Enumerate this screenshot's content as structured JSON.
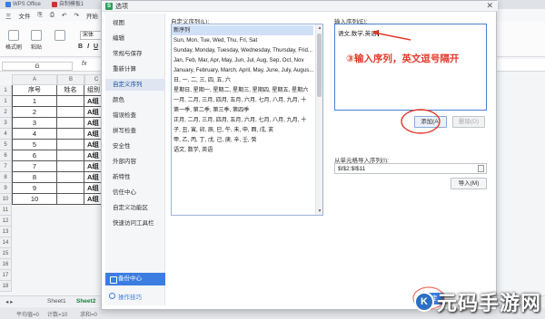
{
  "top_tabs": [
    {
      "label": "WPS Office"
    },
    {
      "label": "自制模板1"
    }
  ],
  "menu": [
    "三",
    "文件",
    "⎘",
    "⎙",
    "↶",
    "↷",
    "开始"
  ],
  "ribbon": {
    "format_painter": "格式刷",
    "paste": "粘贴",
    "font_name": "宋体"
  },
  "name_box": "G",
  "formula_icon": "fx",
  "columns": [
    "A",
    "B",
    "C"
  ],
  "sheet": {
    "headers": {
      "seq": "序号",
      "name": "姓名",
      "group": "组别"
    },
    "rows": [
      {
        "num": "1",
        "seq": "1",
        "group": "A组"
      },
      {
        "num": "2",
        "seq": "2",
        "group": "A组"
      },
      {
        "num": "3",
        "seq": "3",
        "group": "A组"
      },
      {
        "num": "4",
        "seq": "4",
        "group": "A组"
      },
      {
        "num": "5",
        "seq": "5",
        "group": "A组"
      },
      {
        "num": "6",
        "seq": "6",
        "group": "A组"
      },
      {
        "num": "7",
        "seq": "7",
        "group": "A组"
      },
      {
        "num": "8",
        "seq": "8",
        "group": "A组"
      },
      {
        "num": "9",
        "seq": "9",
        "group": "A组"
      },
      {
        "num": "10",
        "seq": "10",
        "group": "A组"
      }
    ],
    "header_row_num": "1",
    "row_nums": [
      "11",
      "12",
      "13",
      "14",
      "15",
      "16",
      "17",
      "18"
    ],
    "tabs": [
      "Sheet1",
      "Sheet2"
    ]
  },
  "status": {
    "left": "平均值=0",
    "count": "计数=10",
    "sum": "求和=0"
  },
  "dialog": {
    "title": "选项",
    "sidebar": [
      "视图",
      "编辑",
      "常规与保存",
      "重新计算",
      "自定义序列",
      "颜色",
      "错误检查",
      "拼写检查",
      "安全性",
      "外部内容",
      "新特性",
      "信任中心",
      "自定义功能区",
      "快速访问工具栏"
    ],
    "active_index": 4,
    "backup_label": "备份中心",
    "tips_label": "操作技巧",
    "custom_list_label": "自定义序列(L):",
    "custom_lists": [
      "新序列",
      "Sun, Mon, Tue, Wed, Thu, Fri, Sat",
      "Sunday, Monday, Tuesday, Wednesday, Thursday, Frid...",
      "Jan, Feb, Mar, Apr, May, Jun, Jul, Aug, Sep, Oct, Nov",
      "January, February, March, April, May, June, July, Augus...",
      "日, 一, 二, 三, 四, 五, 六",
      "星期日, 星期一, 星期二, 星期三, 星期四, 星期五, 星期六",
      "一月, 二月, 三月, 四月, 五月, 六月, 七月, 八月, 九月, 十",
      "第一季, 第二季, 第三季, 第四季",
      "正月, 二月, 三月, 四月, 五月, 六月, 七月, 八月, 九月, 十",
      "子, 丑, 寅, 卯, 辰, 巳, 午, 未, 申, 酉, 戌, 亥",
      "甲, 乙, 丙, 丁, 戊, 己, 庚, 辛, 壬, 癸",
      "语文, 数学, 英语"
    ],
    "selected_list": 0,
    "input_label": "输入序列(E):",
    "input_value": "语文,数学,英语",
    "annotation": "③输入序列，英文逗号隔开",
    "add_button": "添加(A)",
    "delete_button": "删除(D)",
    "import_label": "从单元格导入序列(I):",
    "import_range": "$I$2:$I$11",
    "import_button": "导入(M)",
    "ok_button": "确定"
  },
  "watermark": {
    "logo": "K",
    "text": "元码手游网"
  },
  "colors": {
    "accent": "#3b7de0",
    "annotation": "#e23a2a",
    "selection": "#cfe0f7"
  }
}
